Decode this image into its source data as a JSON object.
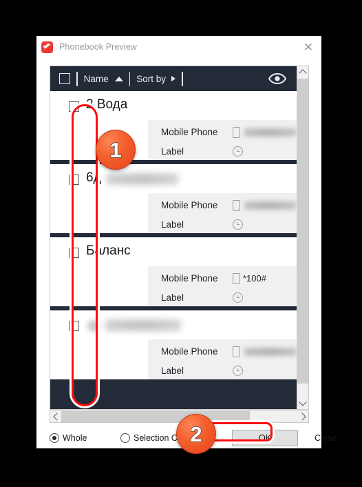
{
  "window": {
    "title": "Phonebook Preview",
    "app_icon": "phonebook-app-icon",
    "close_icon": "close-icon"
  },
  "toolbar": {
    "select_all_checkbox": "select-all-checkbox",
    "name_label": "Name",
    "sort_arrow_icon": "sort-ascending-triangle-icon",
    "sort_by_label": "Sort by",
    "sort_by_arrow_icon": "chevron-right-icon",
    "eye_icon": "eye-visibility-icon"
  },
  "contacts": [
    {
      "name": "2 Вода",
      "name_blurred": false,
      "rows": [
        {
          "label": "Mobile Phone",
          "icon": "mobile-phone-icon",
          "value": "",
          "value_blurred": true
        },
        {
          "label": "Label",
          "icon": "clock-icon",
          "value": "",
          "value_blurred": false
        }
      ]
    },
    {
      "name": "6д",
      "name_blurred": true,
      "rows": [
        {
          "label": "Mobile Phone",
          "icon": "mobile-phone-icon",
          "value": "",
          "value_blurred": true
        },
        {
          "label": "Label",
          "icon": "clock-icon",
          "value": "",
          "value_blurred": false
        }
      ]
    },
    {
      "name": "Баланс",
      "name_blurred": false,
      "rows": [
        {
          "label": "Mobile Phone",
          "icon": "mobile-phone-icon",
          "value": "*100#",
          "value_blurred": false
        },
        {
          "label": "Label",
          "icon": "clock-icon",
          "value": "",
          "value_blurred": false
        }
      ]
    },
    {
      "name": "",
      "name_blurred": true,
      "rows": [
        {
          "label": "Mobile Phone",
          "icon": "mobile-phone-icon",
          "value": "",
          "value_blurred": true
        },
        {
          "label": "Label",
          "icon": "clock-icon",
          "value": "",
          "value_blurred": false
        }
      ]
    }
  ],
  "footer": {
    "radio_whole": "Whole",
    "radio_selection": "Selection O",
    "radio_selected": "Whole",
    "ok_label": "OK",
    "close_label": "Close"
  },
  "scrollbars": {
    "v_up_icon": "chevron-up-icon",
    "v_down_icon": "chevron-down-icon",
    "h_left_icon": "chevron-left-icon",
    "h_right_icon": "chevron-right-icon"
  },
  "annotations": {
    "badge_one": "1",
    "badge_two": "2",
    "highlight_color": "#fb0d0d"
  }
}
